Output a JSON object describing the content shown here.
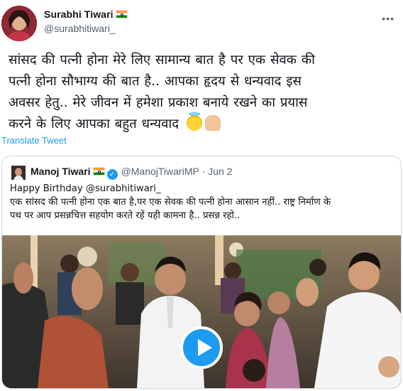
{
  "author": {
    "display_name": "Surabhi Tiwari",
    "handle": "@surabhitiwari_",
    "flag_icon": "india-flag-icon"
  },
  "tweet": {
    "lines": [
      "सांसद की पत्नी होना मेरे लिए सामान्य बात है पर एक सेवक की",
      "पत्नी होना सौभाग्य की बात है.. आपका हृदय से धन्यवाद इस",
      "अवसर हेतु.. मेरे जीवन में हमेशा प्रकाश बनाये रखने का प्रयास",
      "करने के लिए आपका बहुत धन्यवाद"
    ],
    "emojis": [
      "smiling-face-with-halo-icon",
      "folded-hands-icon"
    ],
    "translate_label": "Translate Tweet",
    "more_icon": "more-horizontal-icon"
  },
  "quoted": {
    "display_name": "Manoj Tiwari",
    "handle": "@ManojTiwariMP",
    "separator": "·",
    "date": "Jun 2",
    "verified_icon": "verified-badge-icon",
    "lines": [
      "Happy Birthday @surabhitiwari_",
      "एक सांसद की पत्नी होना एक बात है,पर एक सेवक की पत्नी होना आसान नहीं.. राष्ट्र निर्माण के",
      "पथ पर आप प्रसन्नचित्त सहयोग करते रहें यही कामना है.. प्रसन्न रहो.."
    ],
    "media": {
      "kind": "video-thumbnail",
      "play_icon": "play-icon"
    }
  },
  "colors": {
    "link": "#1d9bf0",
    "secondary_text": "#536471",
    "border": "#cfd9de"
  }
}
